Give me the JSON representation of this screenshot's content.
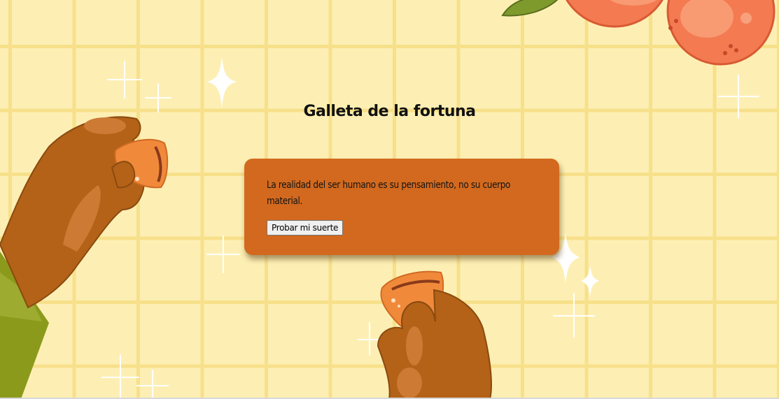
{
  "page": {
    "title": "Galleta de la fortuna"
  },
  "fortune": {
    "text": "La realidad del ser humano es su pensamiento, no su cuerpo material.",
    "button_label": "Probar mi suerte"
  },
  "colors": {
    "background": "#fdefb4",
    "grid": "#f7e08a",
    "card": "#d2691e",
    "orange_fruit": "#f47a52",
    "skin": "#b36217",
    "cookie": "#f08a3a"
  }
}
